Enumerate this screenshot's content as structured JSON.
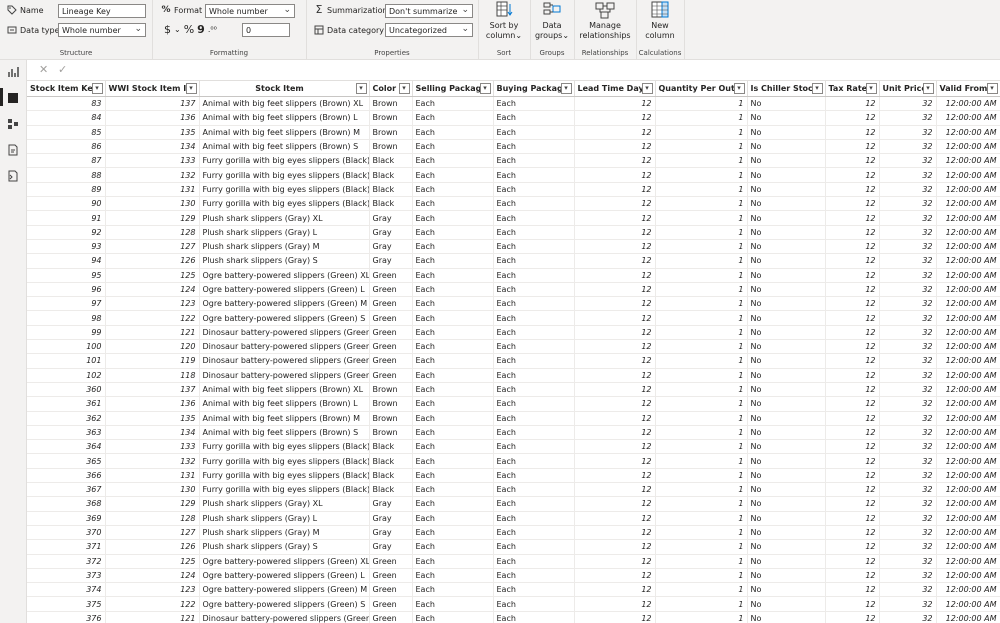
{
  "ribbon": {
    "structure": {
      "name_label": "Name",
      "name_value": "Lineage Key",
      "datatype_label": "Data type",
      "datatype_value": "Whole number",
      "title": "Structure"
    },
    "formatting": {
      "format_label": "Format",
      "format_value": "Whole number",
      "currency": "$",
      "percent": "%",
      "comma": "9",
      "decimals_value": "0",
      "title": "Formatting"
    },
    "properties": {
      "summarization_label": "Summarization",
      "summarization_value": "Don't summarize",
      "category_label": "Data category",
      "category_value": "Uncategorized",
      "title": "Properties"
    },
    "sort": {
      "line1": "Sort by",
      "line2": "column",
      "title": "Sort"
    },
    "groups": {
      "line1": "Data",
      "line2": "groups",
      "title": "Groups"
    },
    "relationships": {
      "line1": "Manage",
      "line2": "relationships",
      "title": "Relationships"
    },
    "calculations": {
      "line1": "New",
      "line2": "column",
      "title": "Calculations"
    }
  },
  "formula_bar": {
    "cancel": "✕",
    "commit": "✓"
  },
  "table": {
    "columns": [
      "Stock Item Key",
      "WWI Stock Item ID",
      "Stock Item",
      "Color",
      "Selling Package",
      "Buying Package",
      "Lead Time Days",
      "Quantity Per Outer",
      "Is Chiller Stock",
      "Tax Rate",
      "Unit Price",
      "Valid From"
    ],
    "rows": [
      [
        "83",
        "137",
        "Animal with big feet slippers (Brown) XL",
        "Brown",
        "Each",
        "Each",
        "12",
        "1",
        "No",
        "12",
        "32",
        "12:00:00 AM"
      ],
      [
        "84",
        "136",
        "Animal with big feet slippers (Brown) L",
        "Brown",
        "Each",
        "Each",
        "12",
        "1",
        "No",
        "12",
        "32",
        "12:00:00 AM"
      ],
      [
        "85",
        "135",
        "Animal with big feet slippers (Brown) M",
        "Brown",
        "Each",
        "Each",
        "12",
        "1",
        "No",
        "12",
        "32",
        "12:00:00 AM"
      ],
      [
        "86",
        "134",
        "Animal with big feet slippers (Brown) S",
        "Brown",
        "Each",
        "Each",
        "12",
        "1",
        "No",
        "12",
        "32",
        "12:00:00 AM"
      ],
      [
        "87",
        "133",
        "Furry gorilla with big eyes slippers (Black) XL",
        "Black",
        "Each",
        "Each",
        "12",
        "1",
        "No",
        "12",
        "32",
        "12:00:00 AM"
      ],
      [
        "88",
        "132",
        "Furry gorilla with big eyes slippers (Black) L",
        "Black",
        "Each",
        "Each",
        "12",
        "1",
        "No",
        "12",
        "32",
        "12:00:00 AM"
      ],
      [
        "89",
        "131",
        "Furry gorilla with big eyes slippers (Black) M",
        "Black",
        "Each",
        "Each",
        "12",
        "1",
        "No",
        "12",
        "32",
        "12:00:00 AM"
      ],
      [
        "90",
        "130",
        "Furry gorilla with big eyes slippers (Black) S",
        "Black",
        "Each",
        "Each",
        "12",
        "1",
        "No",
        "12",
        "32",
        "12:00:00 AM"
      ],
      [
        "91",
        "129",
        "Plush shark slippers (Gray) XL",
        "Gray",
        "Each",
        "Each",
        "12",
        "1",
        "No",
        "12",
        "32",
        "12:00:00 AM"
      ],
      [
        "92",
        "128",
        "Plush shark slippers (Gray) L",
        "Gray",
        "Each",
        "Each",
        "12",
        "1",
        "No",
        "12",
        "32",
        "12:00:00 AM"
      ],
      [
        "93",
        "127",
        "Plush shark slippers (Gray) M",
        "Gray",
        "Each",
        "Each",
        "12",
        "1",
        "No",
        "12",
        "32",
        "12:00:00 AM"
      ],
      [
        "94",
        "126",
        "Plush shark slippers (Gray) S",
        "Gray",
        "Each",
        "Each",
        "12",
        "1",
        "No",
        "12",
        "32",
        "12:00:00 AM"
      ],
      [
        "95",
        "125",
        "Ogre battery-powered slippers (Green) XL",
        "Green",
        "Each",
        "Each",
        "12",
        "1",
        "No",
        "12",
        "32",
        "12:00:00 AM"
      ],
      [
        "96",
        "124",
        "Ogre battery-powered slippers (Green) L",
        "Green",
        "Each",
        "Each",
        "12",
        "1",
        "No",
        "12",
        "32",
        "12:00:00 AM"
      ],
      [
        "97",
        "123",
        "Ogre battery-powered slippers (Green) M",
        "Green",
        "Each",
        "Each",
        "12",
        "1",
        "No",
        "12",
        "32",
        "12:00:00 AM"
      ],
      [
        "98",
        "122",
        "Ogre battery-powered slippers (Green) S",
        "Green",
        "Each",
        "Each",
        "12",
        "1",
        "No",
        "12",
        "32",
        "12:00:00 AM"
      ],
      [
        "99",
        "121",
        "Dinosaur battery-powered slippers (Green) XL",
        "Green",
        "Each",
        "Each",
        "12",
        "1",
        "No",
        "12",
        "32",
        "12:00:00 AM"
      ],
      [
        "100",
        "120",
        "Dinosaur battery-powered slippers (Green) L",
        "Green",
        "Each",
        "Each",
        "12",
        "1",
        "No",
        "12",
        "32",
        "12:00:00 AM"
      ],
      [
        "101",
        "119",
        "Dinosaur battery-powered slippers (Green) M",
        "Green",
        "Each",
        "Each",
        "12",
        "1",
        "No",
        "12",
        "32",
        "12:00:00 AM"
      ],
      [
        "102",
        "118",
        "Dinosaur battery-powered slippers (Green) S",
        "Green",
        "Each",
        "Each",
        "12",
        "1",
        "No",
        "12",
        "32",
        "12:00:00 AM"
      ],
      [
        "360",
        "137",
        "Animal with big feet slippers (Brown) XL",
        "Brown",
        "Each",
        "Each",
        "12",
        "1",
        "No",
        "12",
        "32",
        "12:00:00 AM"
      ],
      [
        "361",
        "136",
        "Animal with big feet slippers (Brown) L",
        "Brown",
        "Each",
        "Each",
        "12",
        "1",
        "No",
        "12",
        "32",
        "12:00:00 AM"
      ],
      [
        "362",
        "135",
        "Animal with big feet slippers (Brown) M",
        "Brown",
        "Each",
        "Each",
        "12",
        "1",
        "No",
        "12",
        "32",
        "12:00:00 AM"
      ],
      [
        "363",
        "134",
        "Animal with big feet slippers (Brown) S",
        "Brown",
        "Each",
        "Each",
        "12",
        "1",
        "No",
        "12",
        "32",
        "12:00:00 AM"
      ],
      [
        "364",
        "133",
        "Furry gorilla with big eyes slippers (Black) XL",
        "Black",
        "Each",
        "Each",
        "12",
        "1",
        "No",
        "12",
        "32",
        "12:00:00 AM"
      ],
      [
        "365",
        "132",
        "Furry gorilla with big eyes slippers (Black) L",
        "Black",
        "Each",
        "Each",
        "12",
        "1",
        "No",
        "12",
        "32",
        "12:00:00 AM"
      ],
      [
        "366",
        "131",
        "Furry gorilla with big eyes slippers (Black) M",
        "Black",
        "Each",
        "Each",
        "12",
        "1",
        "No",
        "12",
        "32",
        "12:00:00 AM"
      ],
      [
        "367",
        "130",
        "Furry gorilla with big eyes slippers (Black) S",
        "Black",
        "Each",
        "Each",
        "12",
        "1",
        "No",
        "12",
        "32",
        "12:00:00 AM"
      ],
      [
        "368",
        "129",
        "Plush shark slippers (Gray) XL",
        "Gray",
        "Each",
        "Each",
        "12",
        "1",
        "No",
        "12",
        "32",
        "12:00:00 AM"
      ],
      [
        "369",
        "128",
        "Plush shark slippers (Gray) L",
        "Gray",
        "Each",
        "Each",
        "12",
        "1",
        "No",
        "12",
        "32",
        "12:00:00 AM"
      ],
      [
        "370",
        "127",
        "Plush shark slippers (Gray) M",
        "Gray",
        "Each",
        "Each",
        "12",
        "1",
        "No",
        "12",
        "32",
        "12:00:00 AM"
      ],
      [
        "371",
        "126",
        "Plush shark slippers (Gray) S",
        "Gray",
        "Each",
        "Each",
        "12",
        "1",
        "No",
        "12",
        "32",
        "12:00:00 AM"
      ],
      [
        "372",
        "125",
        "Ogre battery-powered slippers (Green) XL",
        "Green",
        "Each",
        "Each",
        "12",
        "1",
        "No",
        "12",
        "32",
        "12:00:00 AM"
      ],
      [
        "373",
        "124",
        "Ogre battery-powered slippers (Green) L",
        "Green",
        "Each",
        "Each",
        "12",
        "1",
        "No",
        "12",
        "32",
        "12:00:00 AM"
      ],
      [
        "374",
        "123",
        "Ogre battery-powered slippers (Green) M",
        "Green",
        "Each",
        "Each",
        "12",
        "1",
        "No",
        "12",
        "32",
        "12:00:00 AM"
      ],
      [
        "375",
        "122",
        "Ogre battery-powered slippers (Green) S",
        "Green",
        "Each",
        "Each",
        "12",
        "1",
        "No",
        "12",
        "32",
        "12:00:00 AM"
      ],
      [
        "376",
        "121",
        "Dinosaur battery-powered slippers (Green) XL",
        "Green",
        "Each",
        "Each",
        "12",
        "1",
        "No",
        "12",
        "32",
        "12:00:00 AM"
      ]
    ]
  }
}
